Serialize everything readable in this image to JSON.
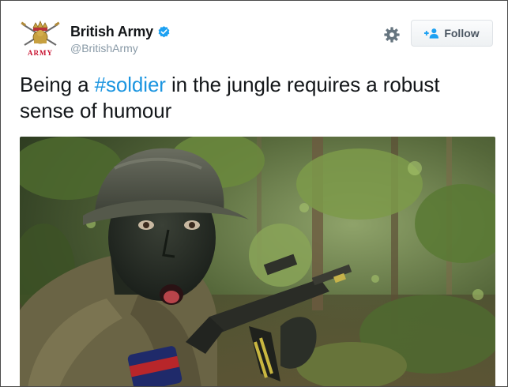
{
  "account": {
    "display_name": "British Army",
    "handle": "@BritishArmy",
    "avatar_text": "ARMY",
    "verified_icon": "verified-badge-icon"
  },
  "actions": {
    "settings_icon": "gear-icon",
    "follow_icon": "follow-person-plus-icon",
    "follow_label": "Follow"
  },
  "tweet": {
    "text_before": "Being a ",
    "hashtag": "#soldier",
    "text_after": " in the jungle requires a robust sense of humour"
  },
  "media": {
    "type": "photo"
  },
  "colors": {
    "link": "#1b95e0",
    "verified": "#1da1f2",
    "avatar_red": "#c8102e"
  }
}
